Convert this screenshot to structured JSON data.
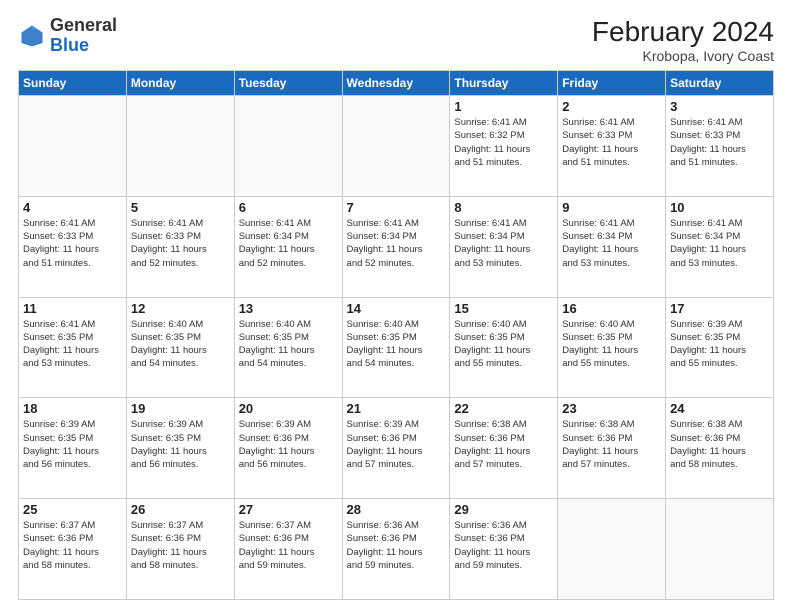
{
  "header": {
    "logo_general": "General",
    "logo_blue": "Blue",
    "month_year": "February 2024",
    "location": "Krobopa, Ivory Coast"
  },
  "days_of_week": [
    "Sunday",
    "Monday",
    "Tuesday",
    "Wednesday",
    "Thursday",
    "Friday",
    "Saturday"
  ],
  "weeks": [
    [
      {
        "day": "",
        "info": ""
      },
      {
        "day": "",
        "info": ""
      },
      {
        "day": "",
        "info": ""
      },
      {
        "day": "",
        "info": ""
      },
      {
        "day": "1",
        "info": "Sunrise: 6:41 AM\nSunset: 6:32 PM\nDaylight: 11 hours\nand 51 minutes."
      },
      {
        "day": "2",
        "info": "Sunrise: 6:41 AM\nSunset: 6:33 PM\nDaylight: 11 hours\nand 51 minutes."
      },
      {
        "day": "3",
        "info": "Sunrise: 6:41 AM\nSunset: 6:33 PM\nDaylight: 11 hours\nand 51 minutes."
      }
    ],
    [
      {
        "day": "4",
        "info": "Sunrise: 6:41 AM\nSunset: 6:33 PM\nDaylight: 11 hours\nand 51 minutes."
      },
      {
        "day": "5",
        "info": "Sunrise: 6:41 AM\nSunset: 6:33 PM\nDaylight: 11 hours\nand 52 minutes."
      },
      {
        "day": "6",
        "info": "Sunrise: 6:41 AM\nSunset: 6:34 PM\nDaylight: 11 hours\nand 52 minutes."
      },
      {
        "day": "7",
        "info": "Sunrise: 6:41 AM\nSunset: 6:34 PM\nDaylight: 11 hours\nand 52 minutes."
      },
      {
        "day": "8",
        "info": "Sunrise: 6:41 AM\nSunset: 6:34 PM\nDaylight: 11 hours\nand 53 minutes."
      },
      {
        "day": "9",
        "info": "Sunrise: 6:41 AM\nSunset: 6:34 PM\nDaylight: 11 hours\nand 53 minutes."
      },
      {
        "day": "10",
        "info": "Sunrise: 6:41 AM\nSunset: 6:34 PM\nDaylight: 11 hours\nand 53 minutes."
      }
    ],
    [
      {
        "day": "11",
        "info": "Sunrise: 6:41 AM\nSunset: 6:35 PM\nDaylight: 11 hours\nand 53 minutes."
      },
      {
        "day": "12",
        "info": "Sunrise: 6:40 AM\nSunset: 6:35 PM\nDaylight: 11 hours\nand 54 minutes."
      },
      {
        "day": "13",
        "info": "Sunrise: 6:40 AM\nSunset: 6:35 PM\nDaylight: 11 hours\nand 54 minutes."
      },
      {
        "day": "14",
        "info": "Sunrise: 6:40 AM\nSunset: 6:35 PM\nDaylight: 11 hours\nand 54 minutes."
      },
      {
        "day": "15",
        "info": "Sunrise: 6:40 AM\nSunset: 6:35 PM\nDaylight: 11 hours\nand 55 minutes."
      },
      {
        "day": "16",
        "info": "Sunrise: 6:40 AM\nSunset: 6:35 PM\nDaylight: 11 hours\nand 55 minutes."
      },
      {
        "day": "17",
        "info": "Sunrise: 6:39 AM\nSunset: 6:35 PM\nDaylight: 11 hours\nand 55 minutes."
      }
    ],
    [
      {
        "day": "18",
        "info": "Sunrise: 6:39 AM\nSunset: 6:35 PM\nDaylight: 11 hours\nand 56 minutes."
      },
      {
        "day": "19",
        "info": "Sunrise: 6:39 AM\nSunset: 6:35 PM\nDaylight: 11 hours\nand 56 minutes."
      },
      {
        "day": "20",
        "info": "Sunrise: 6:39 AM\nSunset: 6:36 PM\nDaylight: 11 hours\nand 56 minutes."
      },
      {
        "day": "21",
        "info": "Sunrise: 6:39 AM\nSunset: 6:36 PM\nDaylight: 11 hours\nand 57 minutes."
      },
      {
        "day": "22",
        "info": "Sunrise: 6:38 AM\nSunset: 6:36 PM\nDaylight: 11 hours\nand 57 minutes."
      },
      {
        "day": "23",
        "info": "Sunrise: 6:38 AM\nSunset: 6:36 PM\nDaylight: 11 hours\nand 57 minutes."
      },
      {
        "day": "24",
        "info": "Sunrise: 6:38 AM\nSunset: 6:36 PM\nDaylight: 11 hours\nand 58 minutes."
      }
    ],
    [
      {
        "day": "25",
        "info": "Sunrise: 6:37 AM\nSunset: 6:36 PM\nDaylight: 11 hours\nand 58 minutes."
      },
      {
        "day": "26",
        "info": "Sunrise: 6:37 AM\nSunset: 6:36 PM\nDaylight: 11 hours\nand 58 minutes."
      },
      {
        "day": "27",
        "info": "Sunrise: 6:37 AM\nSunset: 6:36 PM\nDaylight: 11 hours\nand 59 minutes."
      },
      {
        "day": "28",
        "info": "Sunrise: 6:36 AM\nSunset: 6:36 PM\nDaylight: 11 hours\nand 59 minutes."
      },
      {
        "day": "29",
        "info": "Sunrise: 6:36 AM\nSunset: 6:36 PM\nDaylight: 11 hours\nand 59 minutes."
      },
      {
        "day": "",
        "info": ""
      },
      {
        "day": "",
        "info": ""
      }
    ]
  ]
}
